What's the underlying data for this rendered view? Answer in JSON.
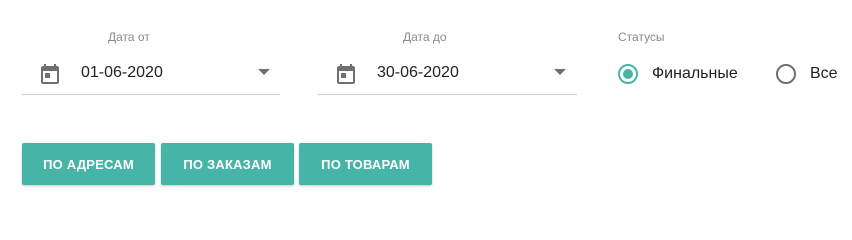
{
  "filters": {
    "date_from": {
      "label": "Дата от",
      "value": "01-06-2020",
      "icon": "calendar-icon"
    },
    "date_to": {
      "label": "Дата до",
      "value": "30-06-2020",
      "icon": "calendar-icon"
    },
    "statuses": {
      "label": "Статусы",
      "options": [
        {
          "label": "Финальные",
          "checked": true
        },
        {
          "label": "Все",
          "checked": false
        }
      ]
    }
  },
  "buttons": {
    "by_addresses": "ПО АДРЕСАМ",
    "by_orders": "ПО ЗАКАЗАМ",
    "by_products": "ПО ТОВАРАМ"
  },
  "colors": {
    "accent": "#46b5a8",
    "icon_gray": "#6f6f6f",
    "label_gray": "#8a8a8a"
  }
}
